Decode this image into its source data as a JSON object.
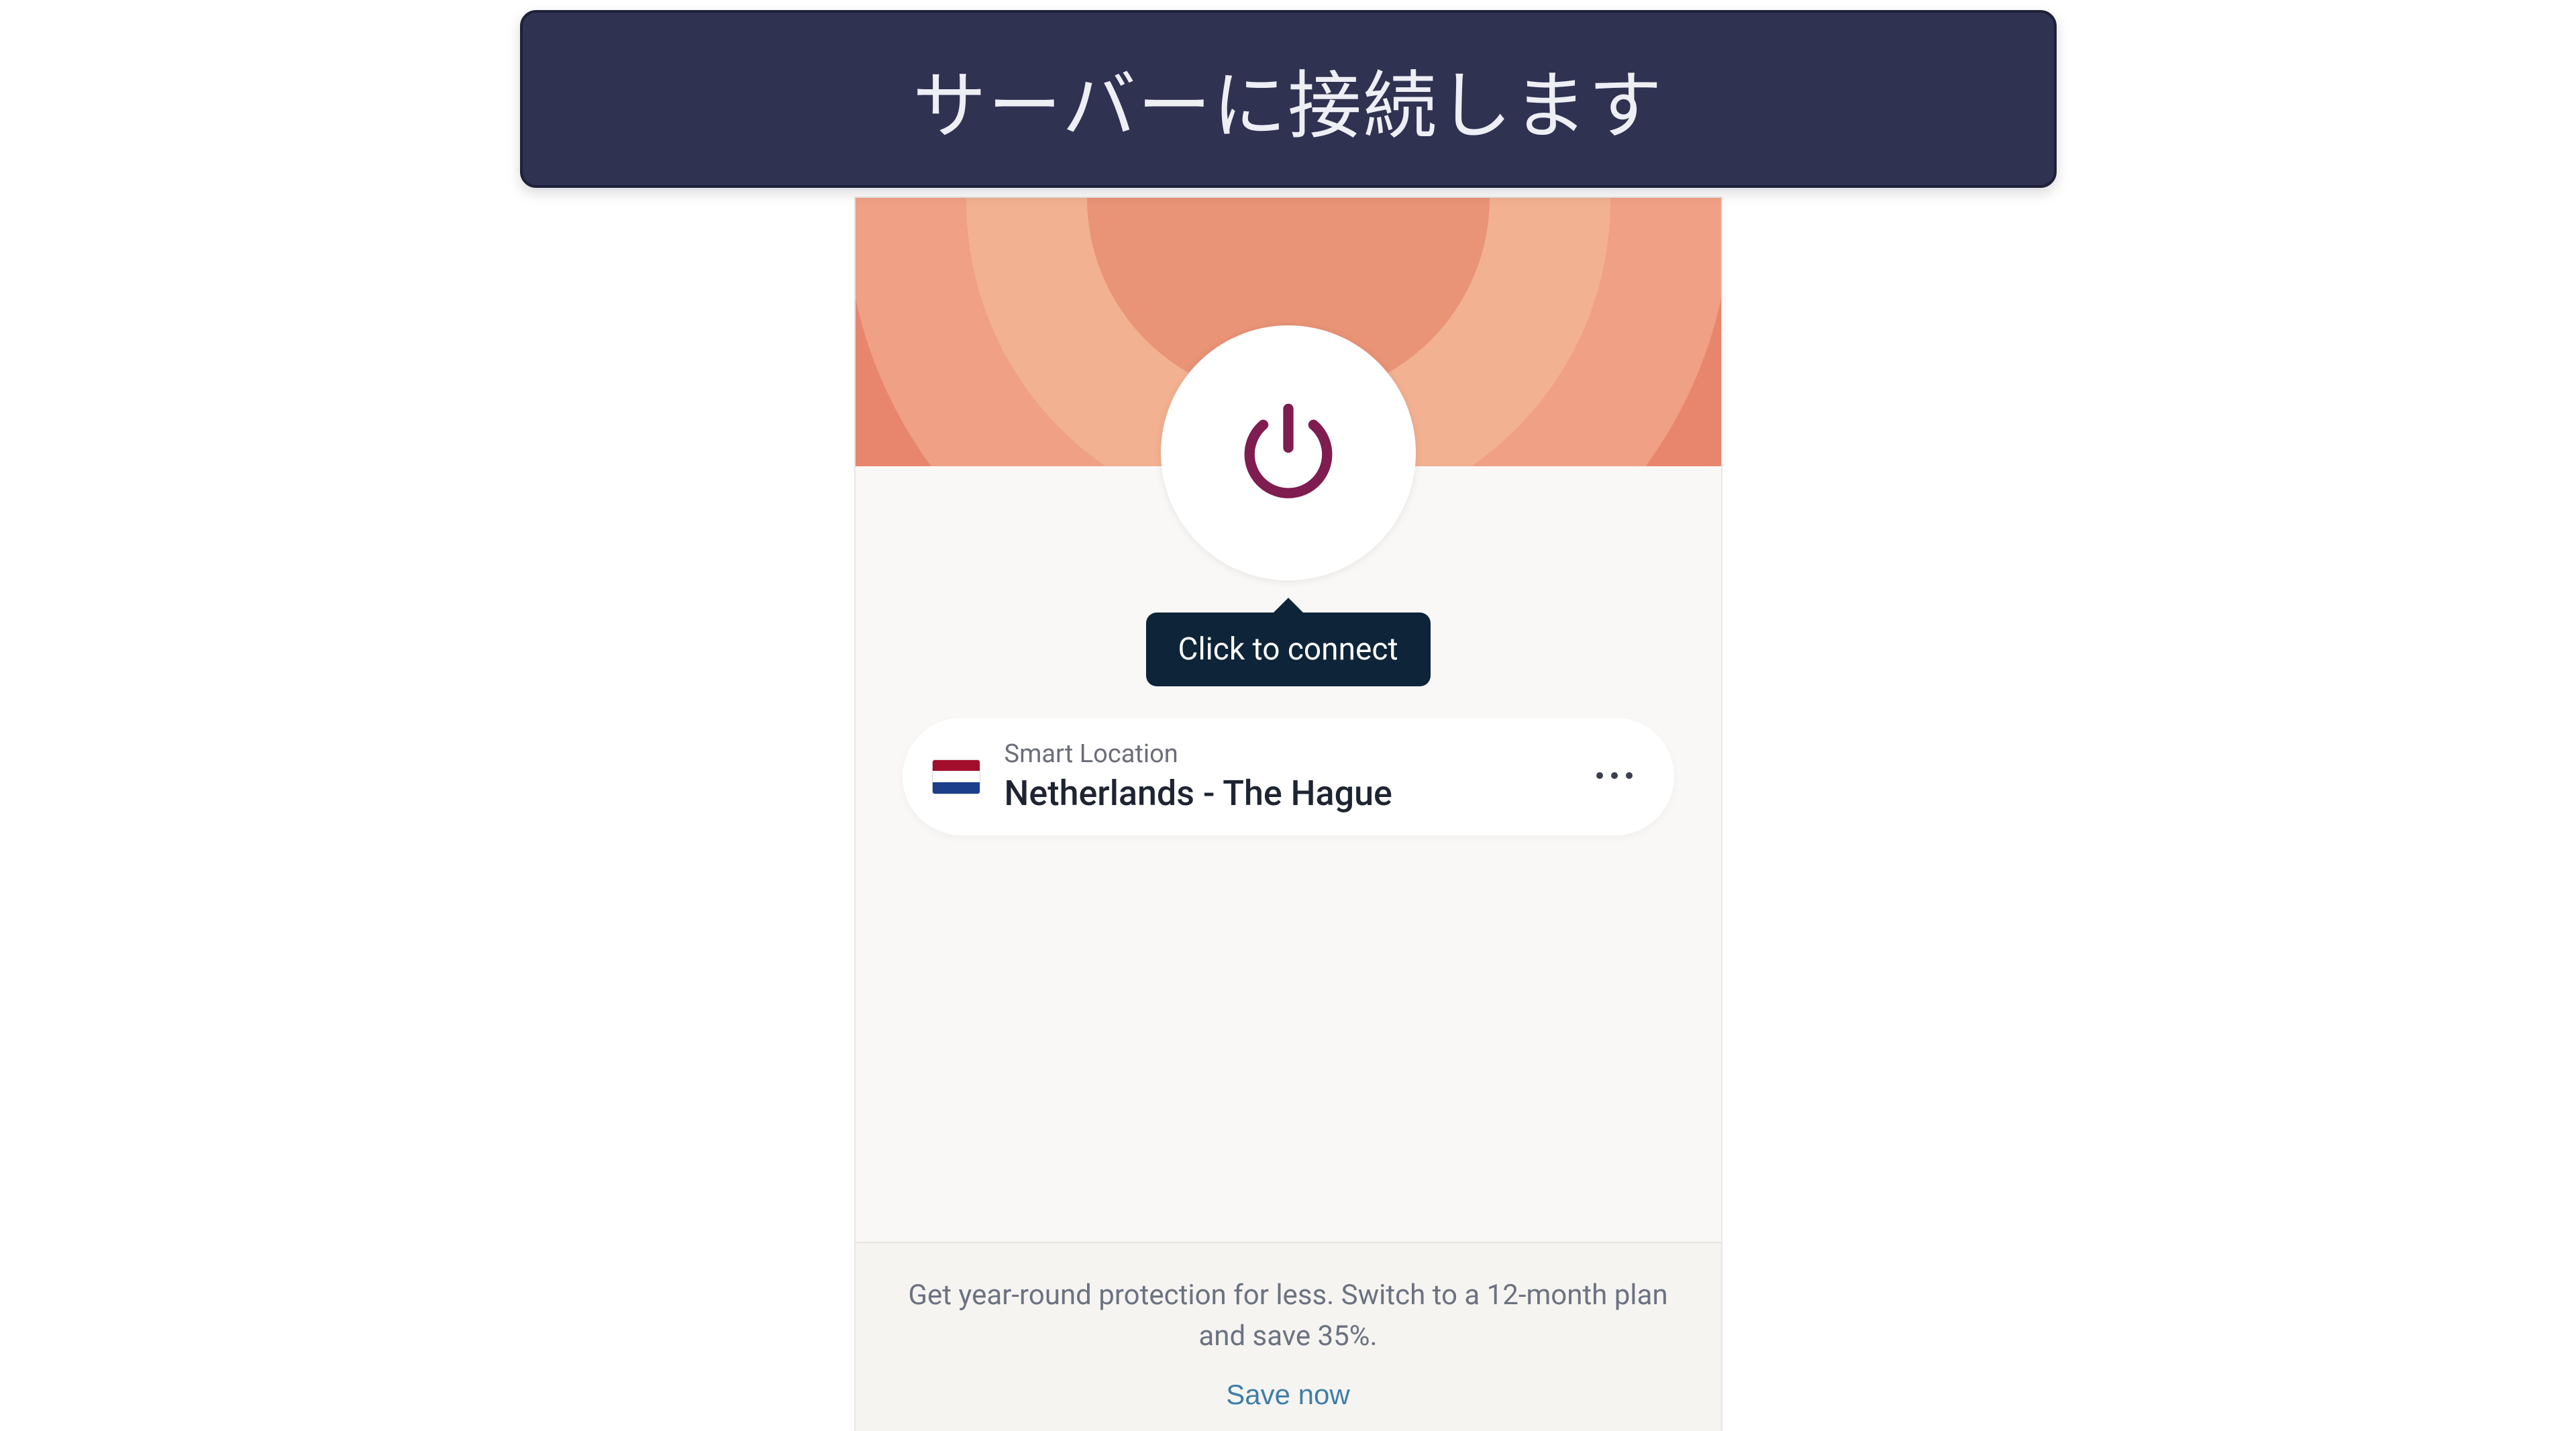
{
  "header": {
    "title": "サーバーに接続します"
  },
  "connect": {
    "tooltip": "Click to connect"
  },
  "location": {
    "label": "Smart Location",
    "name": "Netherlands - The Hague",
    "flag": "netherlands"
  },
  "promo": {
    "message": "Get year-round protection for less. Switch to a 12-month plan and save 35%.",
    "cta": "Save now"
  },
  "colors": {
    "header_bg": "#2f3251",
    "accent": "#7f1c50",
    "tooltip_bg": "#0e2438",
    "link": "#3f7ea8"
  }
}
